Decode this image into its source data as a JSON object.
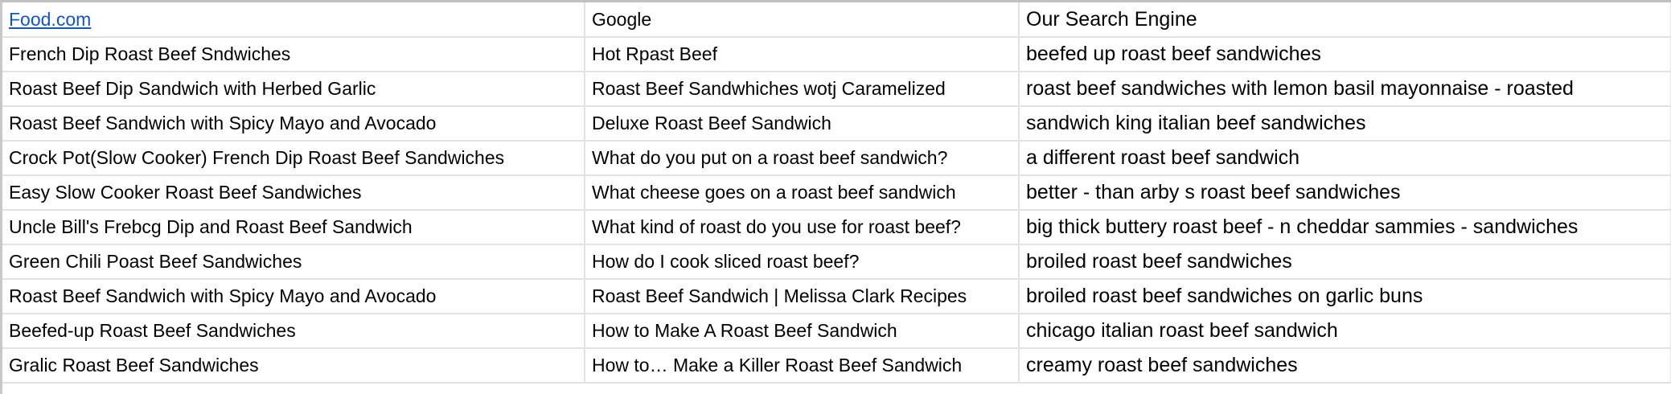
{
  "headers": [
    "Food.com",
    "Google",
    "Our Search Engine"
  ],
  "rows": [
    [
      "French Dip Roast Beef Sndwiches",
      "Hot Rpast Beef",
      "beefed up roast beef sandwiches"
    ],
    [
      "Roast Beef Dip Sandwich with Herbed Garlic",
      "Roast Beef Sandwhiches wotj Caramelized",
      "roast beef sandwiches with lemon basil mayonnaise - roasted"
    ],
    [
      "Roast Beef Sandwich with Spicy Mayo and Avocado",
      "Deluxe Roast Beef Sandwich",
      "sandwich king italian beef sandwiches"
    ],
    [
      "Crock Pot(Slow Cooker) French Dip Roast Beef Sandwiches",
      "What do you put on a roast beef sandwich?",
      "a different roast beef sandwich"
    ],
    [
      "Easy Slow Cooker Roast Beef Sandwiches",
      "What cheese goes on a roast beef sandwich",
      "better - than arby s roast beef sandwiches"
    ],
    [
      "Uncle Bill's Frebcg Dip and Roast Beef Sandwich",
      "What kind of roast do you use for roast beef?",
      "big thick buttery roast beef - n cheddar sammies - sandwiches"
    ],
    [
      "Green Chili Poast Beef Sandwiches",
      "How do I cook sliced roast beef?",
      "broiled roast beef sandwiches"
    ],
    [
      "Roast Beef Sandwich with Spicy Mayo and Avocado",
      "Roast Beef Sandwich | Melissa Clark Recipes",
      "broiled roast beef sandwiches on garlic buns"
    ],
    [
      "Beefed-up Roast Beef Sandwiches",
      "How to Make A Roast Beef Sandwich",
      "chicago italian roast beef sandwich"
    ],
    [
      "Gralic Roast Beef Sandwiches",
      "How to… Make a Killer Roast Beef Sandwich",
      "creamy roast beef sandwiches"
    ]
  ],
  "colors": {
    "link": "#1155cc",
    "grid": "#e2e2e2"
  }
}
